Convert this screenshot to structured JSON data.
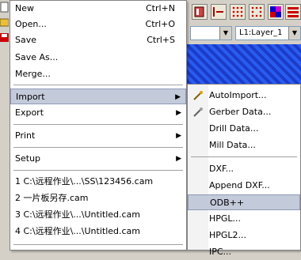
{
  "layer_select": {
    "value": "L1:Layer_1"
  },
  "file_menu": {
    "items": [
      {
        "label": "New",
        "shortcut": "Ctrl+N"
      },
      {
        "label": "Open...",
        "shortcut": "Ctrl+O"
      },
      {
        "label": "Save",
        "shortcut": "Ctrl+S"
      },
      {
        "label": "Save As..."
      },
      {
        "label": "Merge..."
      },
      {
        "label": "Import",
        "submenu": true
      },
      {
        "label": "Export",
        "submenu": true
      },
      {
        "label": "Print",
        "submenu": true
      },
      {
        "label": "Setup",
        "submenu": true
      },
      {
        "label": "1 C:\\远程作业\\...\\SS\\123456.cam"
      },
      {
        "label": "2 一片板另存.cam"
      },
      {
        "label": "3 C:\\远程作业\\...\\Untitled.cam"
      },
      {
        "label": "4 C:\\远程作业\\...\\Untitled.cam"
      }
    ]
  },
  "import_menu": {
    "items": [
      {
        "label": "AutoImport..."
      },
      {
        "label": "Gerber Data..."
      },
      {
        "label": "Drill Data..."
      },
      {
        "label": "Mill Data..."
      },
      {
        "label": "DXF..."
      },
      {
        "label": "Append DXF..."
      },
      {
        "label": "ODB++"
      },
      {
        "label": "HPGL..."
      },
      {
        "label": "HPGL2..."
      },
      {
        "label": "IPC..."
      }
    ]
  },
  "colors": {
    "highlight": "#c3cad9",
    "canvas": "#1a3cc8"
  }
}
